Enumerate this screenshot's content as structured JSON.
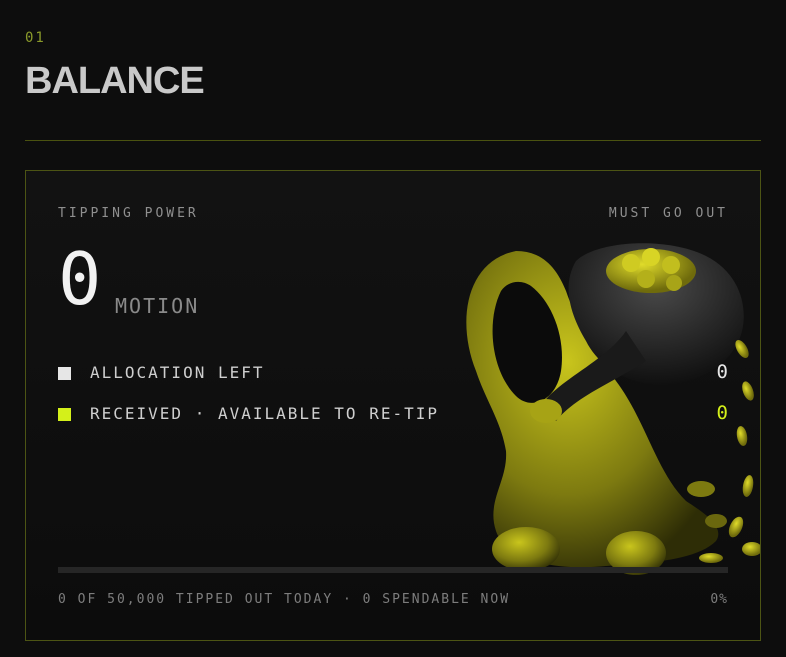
{
  "section": {
    "number": "01",
    "title": "BALANCE"
  },
  "card": {
    "left_label": "TIPPING POWER",
    "right_label": "MUST GO OUT",
    "amount": "0",
    "unit": "MOTION",
    "rows": [
      {
        "label": "ALLOCATION LEFT",
        "value": "0",
        "color": "#e6e6e6"
      },
      {
        "label": "RECEIVED · AVAILABLE TO RE-TIP",
        "value": "0",
        "color": "#d4f01a"
      }
    ],
    "progress": {
      "fraction": 0
    },
    "footer": "0 OF 50,000 TIPPED OUT TODAY · 0 SPENDABLE NOW",
    "percent": "0%"
  },
  "colors": {
    "accent": "#d4f01a",
    "border": "#4c5414",
    "background": "#0d0d0d"
  },
  "illustration": "hooded-figure-carrying-coin-sack-icon"
}
